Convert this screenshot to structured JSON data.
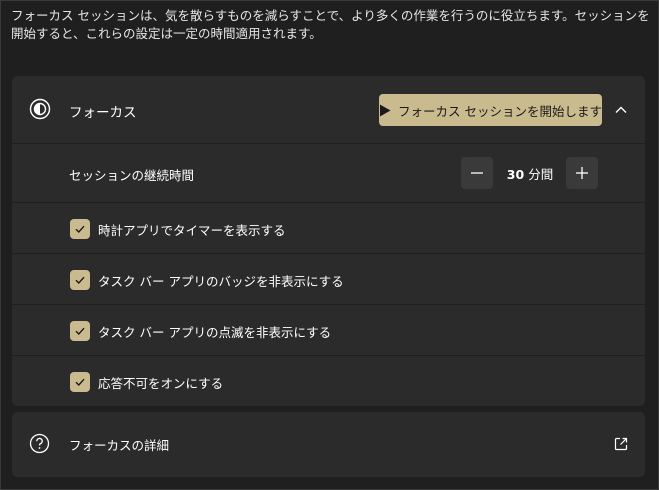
{
  "description": "フォーカス セッションは、気を散らすものを減らすことで、より多くの作業を行うのに役立ちます。セッションを開始すると、これらの設定は一定の時間適用されます。",
  "focus": {
    "title": "フォーカス",
    "start_button_label": "フォーカス セッションを開始します",
    "icon": "focus-icon"
  },
  "duration": {
    "label": "セッションの継続時間",
    "value": "30",
    "unit": "分間",
    "minus": "−",
    "plus": "+"
  },
  "options": [
    {
      "label": "時計アプリでタイマーを表示する",
      "checked": true
    },
    {
      "label": "タスク バー アプリのバッジを非表示にする",
      "checked": true
    },
    {
      "label": "タスク バー アプリの点滅を非表示にする",
      "checked": true
    },
    {
      "label": "応答不可をオンにする",
      "checked": true
    }
  ],
  "details": {
    "title": "フォーカスの詳細",
    "icon": "help-icon"
  },
  "colors": {
    "accent": "#c9bb8d",
    "card": "#2b2b2b",
    "background": "#1f1f1f"
  }
}
